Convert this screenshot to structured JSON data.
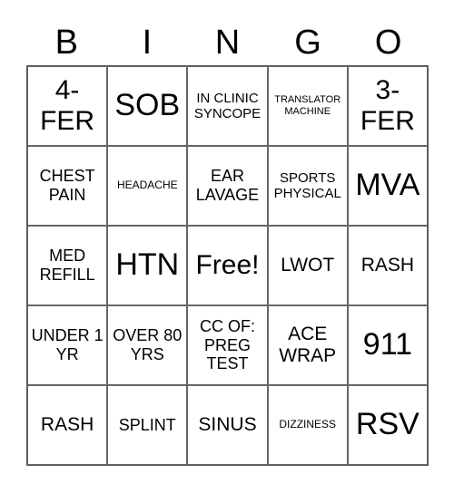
{
  "header": [
    "B",
    "I",
    "N",
    "G",
    "O"
  ],
  "cells": [
    {
      "text": "4-\nFER",
      "size": "s-l"
    },
    {
      "text": "SOB",
      "size": "s-xl"
    },
    {
      "text": "IN CLINIC SYNCOPE",
      "size": "s-xs"
    },
    {
      "text": "TRANSLATOR MACHINE",
      "size": "s-xxxs"
    },
    {
      "text": "3-\nFER",
      "size": "s-l"
    },
    {
      "text": "CHEST PAIN",
      "size": "s-s"
    },
    {
      "text": "HEADACHE",
      "size": "s-xxs"
    },
    {
      "text": "EAR LAVAGE",
      "size": "s-s"
    },
    {
      "text": "SPORTS PHYSICAL",
      "size": "s-xs"
    },
    {
      "text": "MVA",
      "size": "s-xl"
    },
    {
      "text": "MED REFILL",
      "size": "s-s"
    },
    {
      "text": "HTN",
      "size": "s-xl"
    },
    {
      "text": "Free!",
      "size": "s-l"
    },
    {
      "text": "LWOT",
      "size": "s-m"
    },
    {
      "text": "RASH",
      "size": "s-m"
    },
    {
      "text": "UNDER 1 YR",
      "size": "s-s"
    },
    {
      "text": "OVER 80 YRS",
      "size": "s-s"
    },
    {
      "text": "CC OF: PREG TEST",
      "size": "s-s"
    },
    {
      "text": "ACE WRAP",
      "size": "s-m"
    },
    {
      "text": "911",
      "size": "s-xl"
    },
    {
      "text": "RASH",
      "size": "s-m"
    },
    {
      "text": "SPLINT",
      "size": "s-s"
    },
    {
      "text": "SINUS",
      "size": "s-m"
    },
    {
      "text": "DIZZINESS",
      "size": "s-xxs"
    },
    {
      "text": "RSV",
      "size": "s-xl"
    }
  ]
}
